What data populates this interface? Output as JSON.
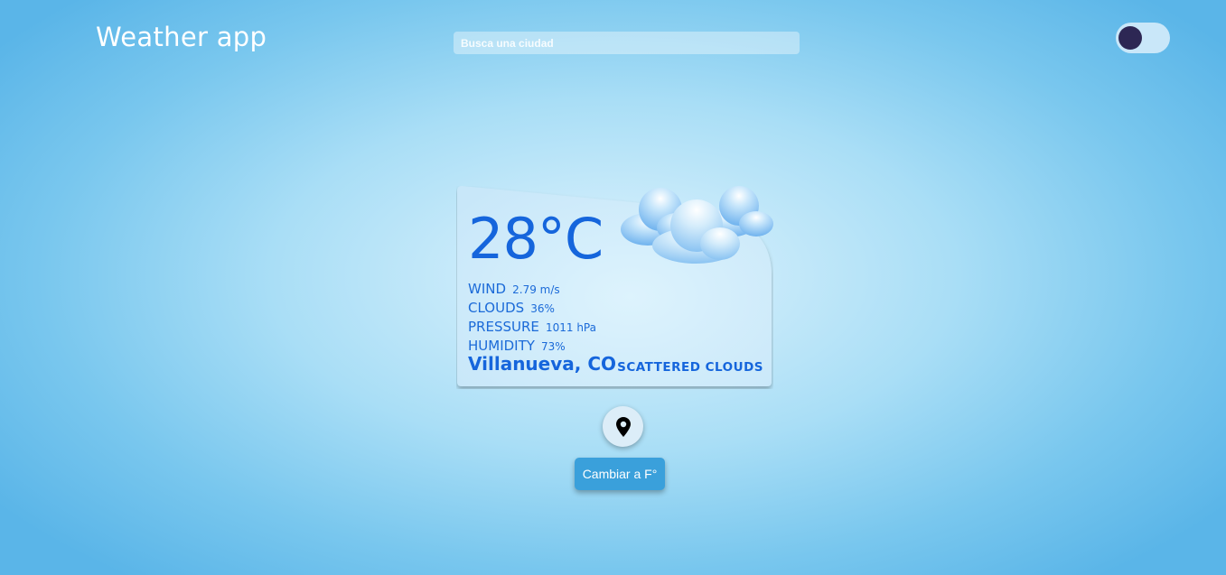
{
  "header": {
    "title": "Weather app",
    "search_placeholder": "Busca una ciudad",
    "toggle_icon": "dark-mode-toggle"
  },
  "weather": {
    "temperature": "28°C",
    "stats": [
      {
        "label": "WIND",
        "value": "2.79 m/s"
      },
      {
        "label": "CLOUDS",
        "value": "36%"
      },
      {
        "label": "PRESSURE",
        "value": "1011 hPa"
      },
      {
        "label": "HUMIDITY",
        "value": "73%"
      }
    ],
    "city": "Villanueva, CO",
    "description": "Scattered Clouds",
    "icon": "scattered-clouds-icon"
  },
  "actions": {
    "location_icon": "location-pin-icon",
    "unit_button_label": "Cambiar a F°"
  },
  "colors": {
    "accent": "#1565dc",
    "button": "#3aa0db",
    "toggle_knob": "#2d2754"
  }
}
